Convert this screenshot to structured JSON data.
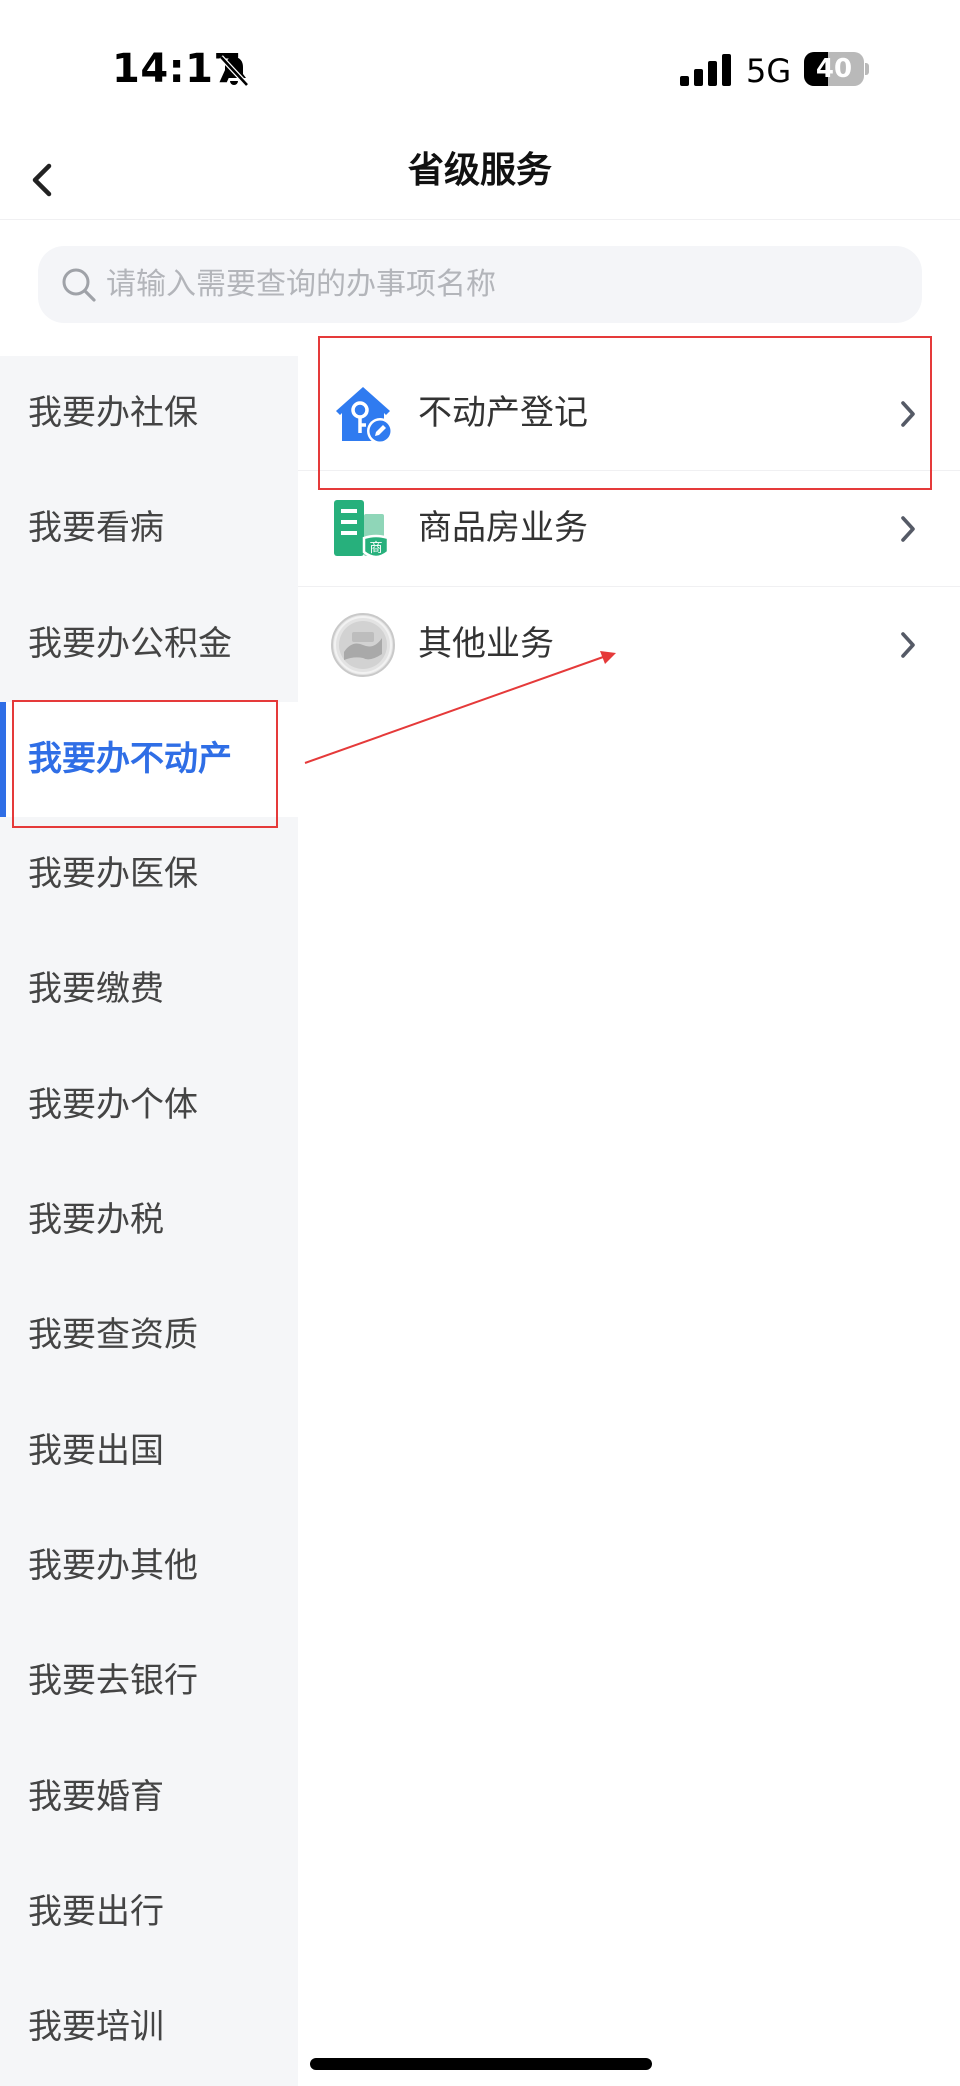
{
  "status_bar": {
    "time": "14:17",
    "network": "5G",
    "battery_level": 40,
    "battery_text": "40"
  },
  "nav": {
    "title": "省级服务"
  },
  "search": {
    "placeholder": "请输入需要查询的办事项名称",
    "value": ""
  },
  "sidebar": {
    "active_index": 3,
    "items": [
      {
        "label": "我要办社保"
      },
      {
        "label": "我要看病"
      },
      {
        "label": "我要办公积金"
      },
      {
        "label": "我要办不动产"
      },
      {
        "label": "我要办医保"
      },
      {
        "label": "我要缴费"
      },
      {
        "label": "我要办个体"
      },
      {
        "label": "我要办税"
      },
      {
        "label": "我要查资质"
      },
      {
        "label": "我要出国"
      },
      {
        "label": "我要办其他"
      },
      {
        "label": "我要去银行"
      },
      {
        "label": "我要婚育"
      },
      {
        "label": "我要出行"
      },
      {
        "label": "我要培训"
      }
    ]
  },
  "services": [
    {
      "label": "不动产登记",
      "icon": "house-key-icon"
    },
    {
      "label": "商品房业务",
      "icon": "commercial-building-icon"
    },
    {
      "label": "其他业务",
      "icon": "emblem-icon"
    }
  ],
  "colors": {
    "accent": "#2f6ee6",
    "annotation": "#e53a3a",
    "sidebar_bg": "#f5f6f8"
  }
}
